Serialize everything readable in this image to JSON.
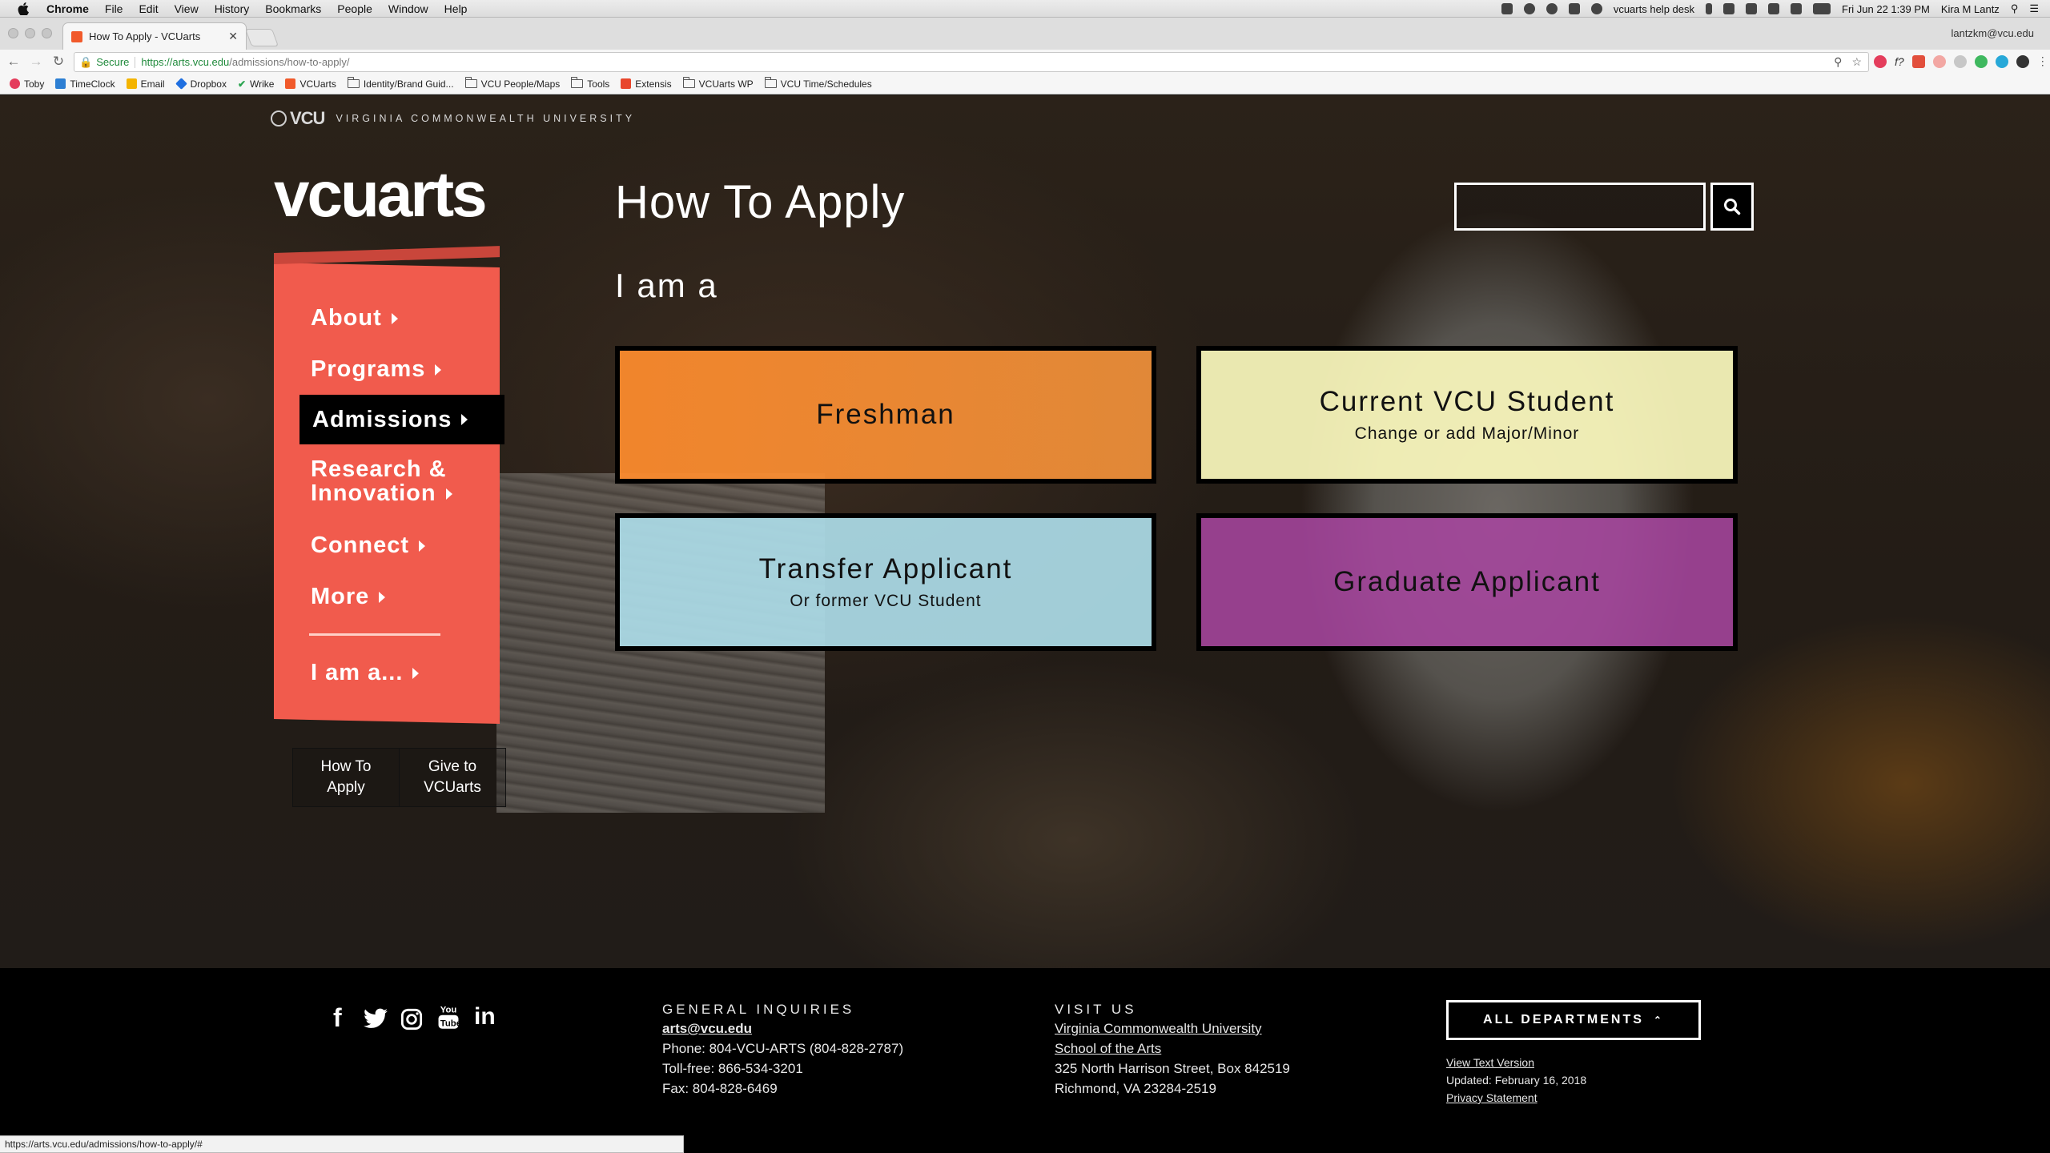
{
  "menubar": {
    "app": "Chrome",
    "items": [
      "File",
      "Edit",
      "View",
      "History",
      "Bookmarks",
      "People",
      "Window",
      "Help"
    ],
    "helpdesk": "vcuarts help desk",
    "datetime": "Fri Jun 22  1:39 PM",
    "user": "Kira M Lantz"
  },
  "browser": {
    "tab_title": "How To Apply - VCUarts",
    "profile_email": "lantzkm@vcu.edu",
    "secure_label": "Secure",
    "url_host": "https://arts.vcu.edu",
    "url_path": "/admissions/how-to-apply/",
    "bookmarks": [
      "Toby",
      "TimeClock",
      "Email",
      "Dropbox",
      "Wrike",
      "VCUarts",
      "Identity/Brand Guid...",
      "VCU People/Maps",
      "Tools",
      "Extensis",
      "VCUarts WP",
      "VCU Time/Schedules"
    ],
    "status_url": "https://arts.vcu.edu/admissions/how-to-apply/#"
  },
  "site": {
    "vcu_mark": "VCU",
    "university": "VIRGINIA COMMONWEALTH UNIVERSITY",
    "logo": "vcuarts",
    "nav": {
      "about": "About",
      "programs": "Programs",
      "admissions": "Admissions",
      "research_line1": "Research &",
      "research_line2": "Innovation",
      "connect": "Connect",
      "more": "More",
      "iam": "I am a..."
    },
    "sub_buttons": {
      "how_line1": "How To",
      "how_line2": "Apply",
      "give_line1": "Give to",
      "give_line2": "VCUarts"
    },
    "page_title": "How To Apply",
    "subtitle": "I am a",
    "search_placeholder": "",
    "cards": {
      "freshman": {
        "title": "Freshman"
      },
      "current": {
        "title": "Current VCU Student",
        "sub": "Change or add Major/Minor"
      },
      "transfer": {
        "title": "Transfer Applicant",
        "sub": "Or former VCU Student"
      },
      "graduate": {
        "title": "Graduate Applicant"
      }
    }
  },
  "footer": {
    "general_heading": "GENERAL INQUIRIES",
    "email": "arts@vcu.edu",
    "phone": "Phone: 804-VCU-ARTS (804-828-2787)",
    "tollfree": "Toll-free: 866-534-3201",
    "fax": "Fax: 804-828-6469",
    "visit_heading": "VISIT US",
    "visit_link1": "Virginia Commonwealth University",
    "visit_link2": "School of the Arts",
    "address1": "325 North Harrison Street, Box 842519",
    "address2": "Richmond, VA 23284-2519",
    "all_departments": "ALL DEPARTMENTS",
    "text_version": "View Text Version",
    "updated": "Updated: February 16, 2018",
    "privacy": "Privacy Statement"
  },
  "colors": {
    "nav_bg": "#f15b4d",
    "freshman": "#ff8c2d",
    "current": "#faf7bc",
    "transfer": "#acdce8",
    "graduate": "#a6469e"
  }
}
